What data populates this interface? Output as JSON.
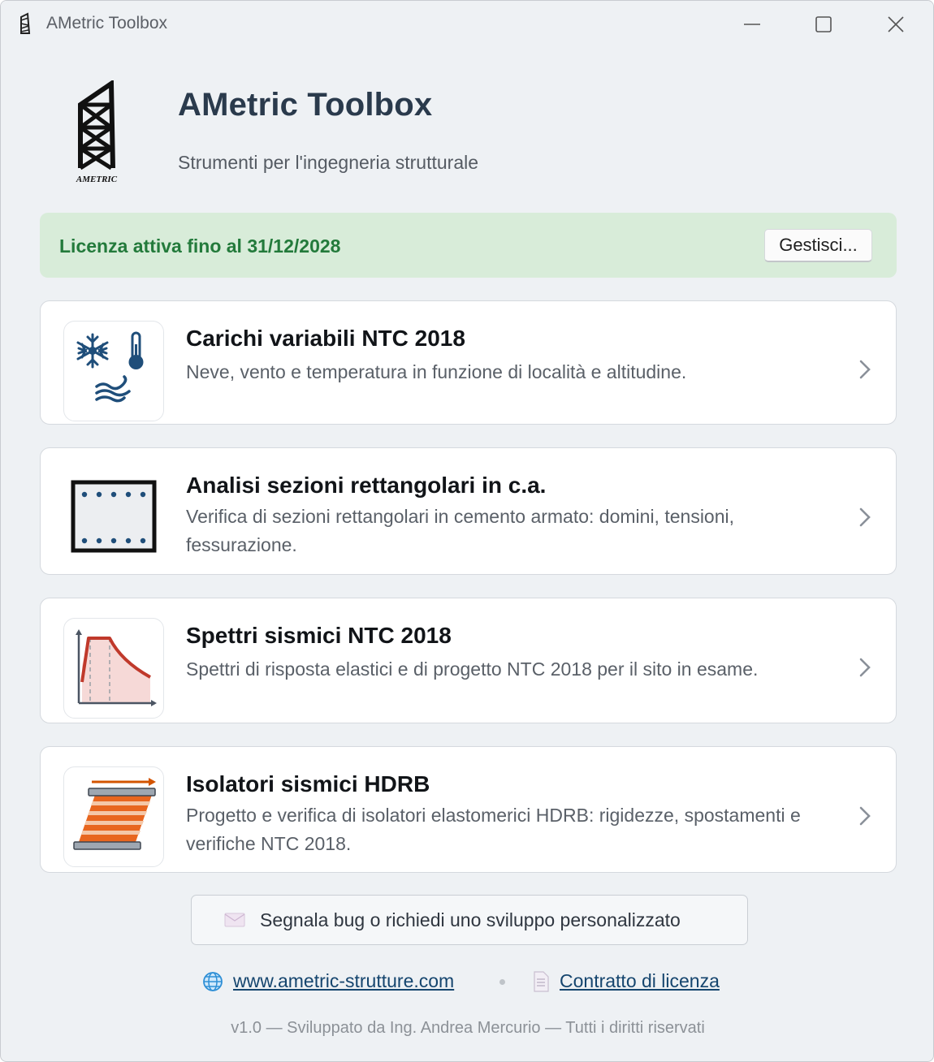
{
  "window": {
    "title": "AMetric Toolbox",
    "controls": {
      "minimize": "minimize-icon",
      "maximize": "maximize-icon",
      "close": "close-icon"
    }
  },
  "header": {
    "logo_text": "AMETRIC",
    "title": "AMetric Toolbox",
    "subtitle": "Strumenti per l'ingegneria strutturale"
  },
  "license": {
    "status": "Licenza attiva fino al 31/12/2028",
    "manage_label": "Gestisci...",
    "color": "#237a3b",
    "background": "#d8ecd9"
  },
  "tools": [
    {
      "title": "Carichi variabili NTC 2018",
      "description": "Neve, vento e temperatura in funzione di località e altitudine.",
      "icon": "snow-thermometer-wind-icon"
    },
    {
      "title": "Analisi sezioni rettangolari in c.a.",
      "description": "Verifica di sezioni rettangolari in cemento armato: domini, tensioni, fessurazione.",
      "icon": "rc-section-icon"
    },
    {
      "title": "Spettri sismici NTC 2018",
      "description": "Spettri di risposta elastici e di progetto NTC 2018 per il sito in esame.",
      "icon": "response-spectrum-icon"
    },
    {
      "title": "Isolatori sismici HDRB",
      "description": "Progetto e verifica di isolatori elastomerici HDRB: rigidezze, spostamenti e verifiche NTC 2018.",
      "icon": "hdrb-isolator-icon"
    }
  ],
  "actions": {
    "bug_report_label": "Segnala bug o richiedi uno sviluppo personalizzato",
    "bug_report_icon": "envelope-icon"
  },
  "links": {
    "website": "www.ametric-strutture.com",
    "website_icon": "globe-icon",
    "license_contract": "Contratto di licenza",
    "license_icon": "document-icon"
  },
  "footer": {
    "text": "v1.0 — Sviluppato da Ing. Andrea Mercurio — Tutti i diritti riservati"
  },
  "colors": {
    "background": "#eef1f4",
    "card": "#ffffff",
    "title": "#2a3a4c",
    "link": "#15456e",
    "accent_orange": "#e8661f",
    "spectrum_red": "#c0392b",
    "icon_blue": "#1f4e7a"
  }
}
